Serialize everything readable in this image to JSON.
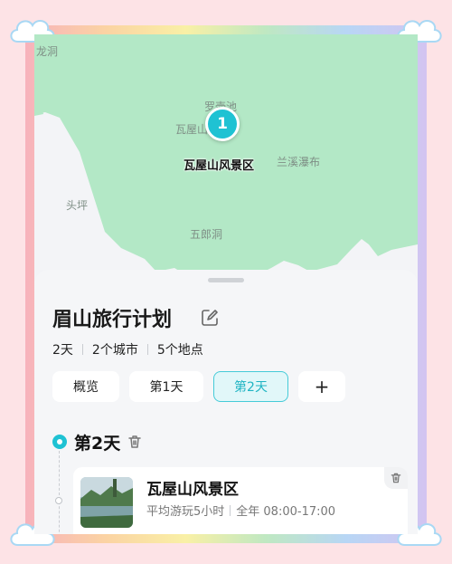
{
  "map": {
    "labels": {
      "longdong": "龙洞",
      "luoyuchi": "罗壶池",
      "gong": "瓦屋山宫",
      "lanxi": "兰溪瀑布",
      "touping": "头坪",
      "wulangdong": "五郎洞"
    },
    "pin_number": "1",
    "pin_label": "瓦屋山风景区",
    "colors": {
      "land": "#b3e8c6",
      "water": "#f3f4f7"
    }
  },
  "plan": {
    "title": "眉山旅行计划",
    "stats": [
      "2天",
      "2个城市",
      "5个地点"
    ],
    "tabs": [
      {
        "label": "概览",
        "active": false
      },
      {
        "label": "第1天",
        "active": false
      },
      {
        "label": "第2天",
        "active": true
      },
      {
        "label": "+",
        "active": false
      }
    ]
  },
  "day": {
    "title": "第2天",
    "place": {
      "name": "瓦屋山风景区",
      "duration": "平均游玩5小时",
      "hours": "全年 08:00-17:00"
    }
  },
  "accent": "#1fc2d3"
}
